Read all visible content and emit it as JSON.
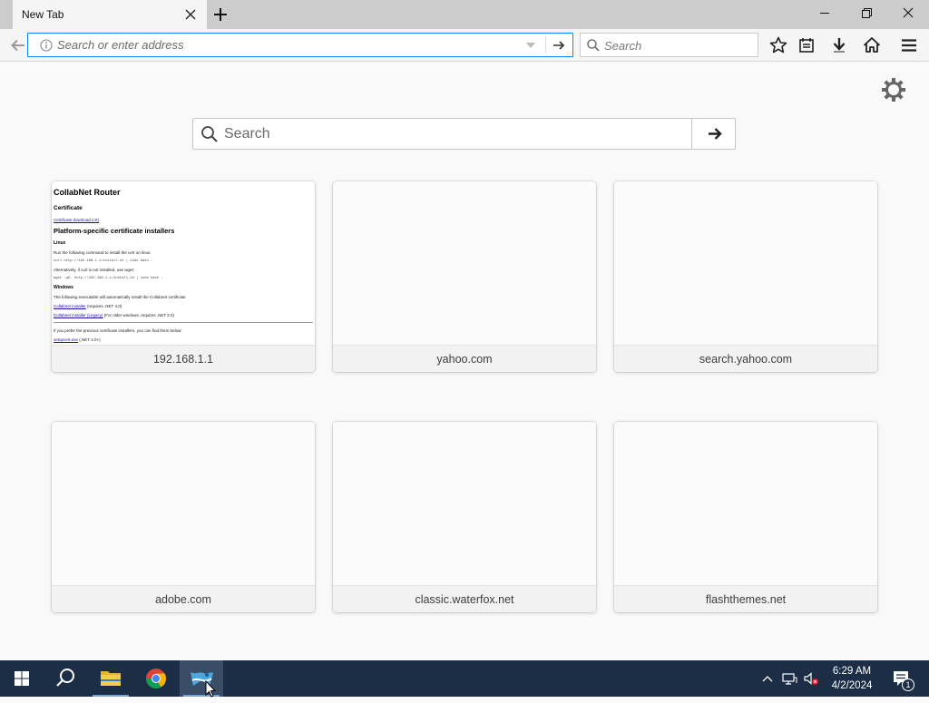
{
  "browser": {
    "tab_title": "New Tab",
    "urlbar_placeholder": "Search or enter address",
    "searchbar_placeholder": "Search"
  },
  "content": {
    "search_placeholder": "Search",
    "tiles": [
      {
        "label": "192.168.1.1"
      },
      {
        "label": "yahoo.com"
      },
      {
        "label": "search.yahoo.com"
      },
      {
        "label": "adobe.com"
      },
      {
        "label": "classic.waterfox.net"
      },
      {
        "label": "flashthemes.net"
      }
    ],
    "thumbnail": {
      "title": "CollabNet Router",
      "certificate_heading": "Certificate",
      "certificate_link": "Certificate download (crt)",
      "platform_heading": "Platform-specific certificate installers",
      "linux_heading": "Linux",
      "linux_text": "Run the following command to install the cert on linux:",
      "linux_cmd": "curl http://192.168.1.1/install.sh | sudo bash -",
      "alt_text": "Alternatively, if curl is not installed, use wget:",
      "alt_cmd": "wget -qO- http://192.168.1.1/install.sh | sudo bash -",
      "windows_heading": "Windows",
      "windows_text": "The following executable will automatically install the Collabnet certificate",
      "installer_link": "Collabnet installer",
      "installer_note": "(requires .NET 4.0)",
      "legacy_link": "Collabnet installer (Legacy)",
      "legacy_note": "(For older windows, requires .NET 2.0)",
      "prev_text": "If you prefer the previous certificate installers, you can find them below:",
      "prev_link": "setupcert.exe",
      "prev_note": "(.NET 4.0+)"
    }
  },
  "taskbar": {
    "time": "6:29 AM",
    "date": "4/2/2024",
    "notification_count": "1"
  },
  "colors": {
    "accent": "#0a84ff",
    "taskbar": "#1c2e46",
    "titlebar": "#cccccc"
  }
}
